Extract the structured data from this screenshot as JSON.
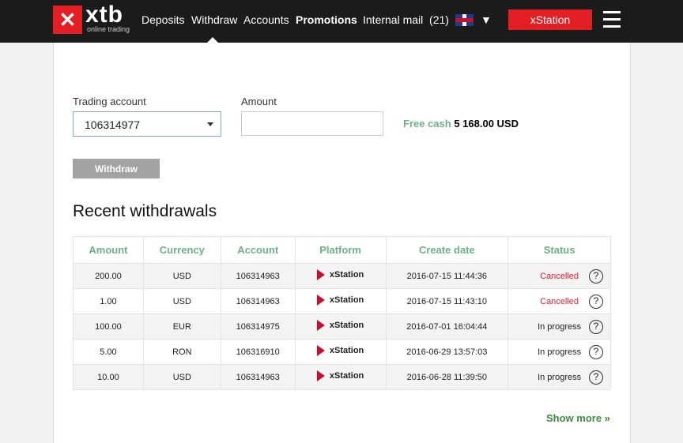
{
  "header": {
    "brand": "xtb",
    "brand_sub": "online trading",
    "nav": [
      "Deposits",
      "Withdraw",
      "Accounts",
      "Promotions",
      "Internal mail  (21)"
    ],
    "language_icon": "uk-flag-icon",
    "xstation_label": "xStation",
    "accent": "#e31e24"
  },
  "form": {
    "account_label": "Trading account",
    "account_value": "106314977",
    "amount_label": "Amount",
    "amount_value": "",
    "free_cash_label": "Free cash",
    "free_cash_value": "5 168.00 USD",
    "withdraw_label": "Withdraw"
  },
  "recent": {
    "title": "Recent withdrawals",
    "columns": [
      "Amount",
      "Currency",
      "Account",
      "Platform",
      "Create date",
      "Status"
    ],
    "rows": [
      [
        "200.00",
        "USD",
        "106314963",
        "xStation",
        "2016-07-15 11:44:36",
        "Cancelled"
      ],
      [
        "1.00",
        "USD",
        "106314963",
        "xStation",
        "2016-07-15 11:43:10",
        "Cancelled"
      ],
      [
        "100.00",
        "EUR",
        "106314975",
        "xStation",
        "2016-07-01 16:04:44",
        "In progress"
      ],
      [
        "5.00",
        "RON",
        "106316910",
        "xStation",
        "2016-06-29 13:57:03",
        "In progress"
      ],
      [
        "10.00",
        "USD",
        "106314963",
        "xStation",
        "2016-06-28 11:39:50",
        "In progress"
      ]
    ],
    "show_more": "Show more »"
  }
}
